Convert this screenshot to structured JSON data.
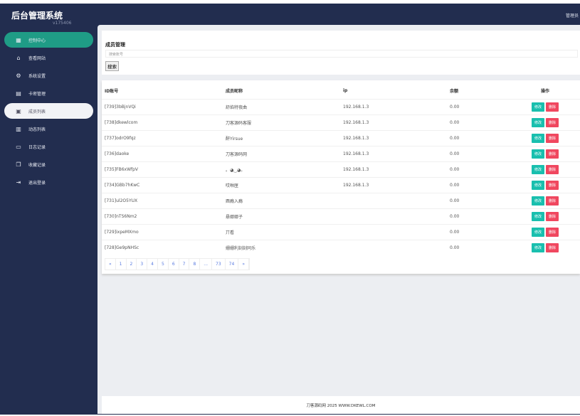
{
  "app": {
    "title": "后台管理系统",
    "version": "v175406",
    "user": "管理员"
  },
  "sidebar": {
    "items": [
      {
        "label": "控制中心",
        "icon": "grid-icon",
        "glyph": "▦"
      },
      {
        "label": "查看网站",
        "icon": "home-icon",
        "glyph": "⌂"
      },
      {
        "label": "系统设置",
        "icon": "gear-icon",
        "glyph": "⚙"
      },
      {
        "label": "卡密管理",
        "icon": "list-icon",
        "glyph": "▤"
      },
      {
        "label": "成员列表",
        "icon": "contacts-icon",
        "glyph": "▣"
      },
      {
        "label": "动态列表",
        "icon": "table-icon",
        "glyph": "▥"
      },
      {
        "label": "日志记录",
        "icon": "message-icon",
        "glyph": "▭"
      },
      {
        "label": "收藏记录",
        "icon": "copy-icon",
        "glyph": "❐"
      },
      {
        "label": "退出登录",
        "icon": "logout-icon",
        "glyph": "⇥"
      }
    ]
  },
  "search": {
    "title": "成员管理",
    "placeholder": "搜索账号",
    "button": "搜索"
  },
  "table": {
    "headers": [
      "ID账号",
      "成员昵称",
      "ip",
      "余额",
      "操作"
    ],
    "edit": "修改",
    "delete": "删除",
    "rows": [
      [
        "[739]3bBjnVQi",
        "舒焰特夜曲",
        "192.168.1.3",
        "0.00"
      ],
      [
        "[738]dkewlcom",
        "刀客源码客服",
        "192.168.1.3",
        "0.00"
      ],
      [
        "[737]odrO9fqz",
        "酐Yirsue",
        "192.168.1.3",
        "0.00"
      ],
      [
        "[736]daoke",
        "刀客源码网",
        "192.168.1.3",
        "0.00"
      ],
      [
        "[735]FB6xWfpV",
        "。◕‿◕。",
        "192.168.1.3",
        "0.00"
      ],
      [
        "[734]GBb7hKwC",
        "哎咻匣",
        "192.168.1.3",
        "0.00"
      ],
      [
        "[731]ul2O5YUX",
        "酉瘾入瘾",
        "",
        "0.00"
      ],
      [
        "[730]nTS6Nm2",
        "悬娜娜子",
        "",
        "0.00"
      ],
      [
        "[729]ixpeMXmo",
        "丌看",
        "",
        "0.00"
      ],
      [
        "[728]Ge9pNHSc",
        "姗姗利刻刻同乐",
        "",
        "0.00"
      ]
    ]
  },
  "pagination": [
    "«",
    "1",
    "2",
    "3",
    "4",
    "5",
    "6",
    "7",
    "8",
    "...",
    "73",
    "74",
    "»"
  ],
  "footer": "刀客源码网 2025 WWW.DKEWL.COM"
}
